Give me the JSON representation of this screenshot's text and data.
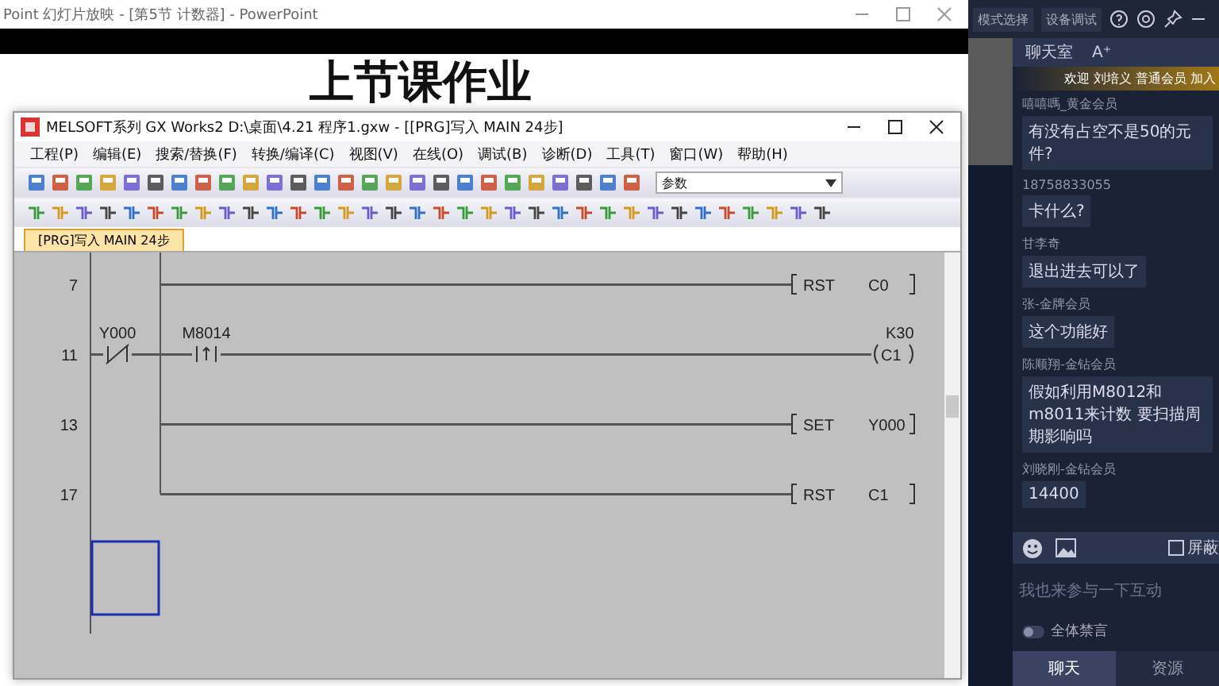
{
  "ppt_window": {
    "title": "Point 幻灯片放映 - [第5节 计数器] - PowerPoint",
    "slide_title": "上节课作业"
  },
  "gx_window": {
    "title": "MELSOFT系列 GX Works2 D:\\桌面\\4.21 程序1.gxw - [[PRG]写入 MAIN 24步]",
    "menu": [
      "工程(P)",
      "编辑(E)",
      "搜索/替换(F)",
      "转换/编译(C)",
      "视图(V)",
      "在线(O)",
      "调试(B)",
      "诊断(D)",
      "工具(T)",
      "窗口(W)",
      "帮助(H)"
    ],
    "search_value": "参数",
    "tabs": [
      {
        "label": "[PRG]写入 MAIN 24步",
        "selected": true
      }
    ],
    "ladder": {
      "rungs": [
        {
          "step": "7",
          "branch": true,
          "output": {
            "kind": "instruction",
            "op": "RST",
            "operand": "C0"
          }
        },
        {
          "step": "11",
          "branch": false,
          "contacts": [
            {
              "device": "Y000",
              "kind": "nc"
            },
            {
              "device": "M8014",
              "kind": "pulse"
            }
          ],
          "output": {
            "kind": "coil",
            "operand": "C1",
            "setting": "K30"
          }
        },
        {
          "step": "13",
          "branch": true,
          "output": {
            "kind": "instruction",
            "op": "SET",
            "operand": "Y000"
          }
        },
        {
          "step": "17",
          "branch": true,
          "output": {
            "kind": "instruction",
            "op": "RST",
            "operand": "C1"
          }
        }
      ]
    }
  },
  "top_bar": {
    "buttons": [
      "模式选择",
      "设备调试"
    ]
  },
  "chat": {
    "title": "聊天室",
    "font_button": "A⁺",
    "welcome": "欢迎 刘培义 普通会员 加入",
    "messages": [
      {
        "user": "嘻嘻嗎_黄金会员",
        "text": "有没有占空不是50的元件?"
      },
      {
        "user": "18758833055",
        "text": "卡什么?"
      },
      {
        "user": "甘李奇",
        "text": "退出进去可以了"
      },
      {
        "user": "张-金牌会员",
        "text": "这个功能好"
      },
      {
        "user": "陈顺翔-金钻会员",
        "text": "假如利用M8012和m8011来计数 要扫描周期影响吗"
      },
      {
        "user": "刘晓刚-金钻会员",
        "text": "14400"
      }
    ],
    "block_checkbox": {
      "label": "屏蔽",
      "checked": false
    },
    "input_placeholder": "我也来参与一下互动",
    "mute_all": {
      "label": "全体禁言",
      "on": false
    },
    "tabs": [
      {
        "label": "聊天",
        "selected": true
      },
      {
        "label": "资源",
        "selected": false
      }
    ]
  }
}
